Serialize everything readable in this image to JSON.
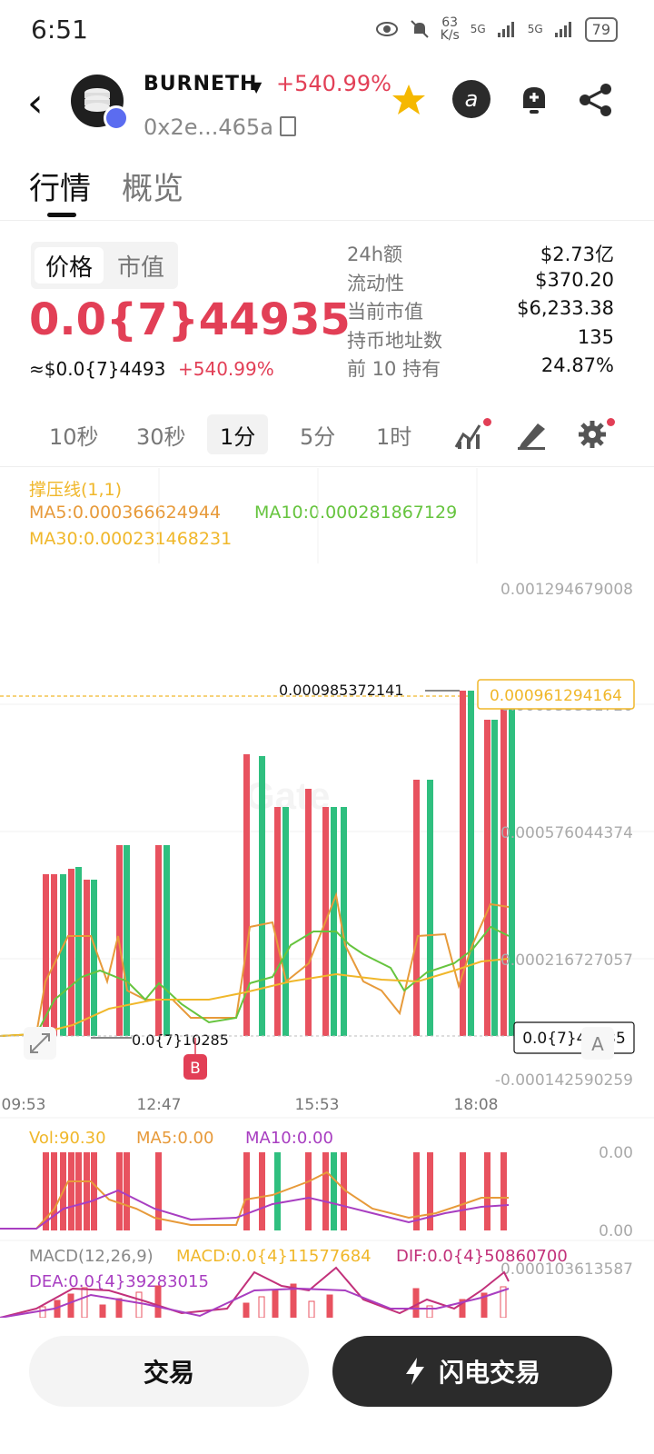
{
  "status_bar": {
    "time": "6:51",
    "net_speed_value": "63",
    "net_speed_unit": "K/s",
    "signal1": "5G",
    "signal2": "5G",
    "battery": "79"
  },
  "header": {
    "coin_name": "BURNETH",
    "change": "+540.99%",
    "address": "0x2e...465a"
  },
  "tabs": {
    "market": "行情",
    "overview": "概览"
  },
  "price_panel": {
    "toggle_price": "价格",
    "toggle_mcap": "市值",
    "price": "0.0{7}44935",
    "usd_price": "≈$0.0{7}4493",
    "usd_change": "+540.99%"
  },
  "stats": [
    {
      "label": "24h额",
      "value": "$2.73亿"
    },
    {
      "label": "流动性",
      "value": "$370.20"
    },
    {
      "label": "当前市值",
      "value": "$6,233.38"
    },
    {
      "label": "持币地址数",
      "value": "135"
    },
    {
      "label": "前 10 持有",
      "value": "24.87%"
    }
  ],
  "timeframes": {
    "items": [
      "10秒",
      "30秒",
      "1分",
      "5分",
      "1时"
    ],
    "selected": "1分"
  },
  "indicators": {
    "sr_line": "撑压线(1,1)",
    "ma5": "MA5:0.000366624944",
    "ma10": "MA10:0.000281867129",
    "ma30": "MA30:0.000231468231"
  },
  "colors": {
    "up": "#e8525f",
    "down": "#2fbf7f",
    "ma5": "#e79a3a",
    "ma10": "#66c43e",
    "ma30": "#f0b72a",
    "purple": "#a83ec1",
    "accent_red": "#e23f56"
  },
  "chart_data": {
    "type": "candlestick",
    "y_ticks": [
      "0.001294679008",
      "0.000576044374",
      "0.000216727057",
      "-0.000142590259"
    ],
    "y_tick_partial": "0.000935381720",
    "current_price_label": "0.000961294164",
    "high_label": "0.000985372141",
    "low_label": "0.0{7}10285",
    "last_price_label": "0.0{7}44935",
    "buy_marker": "B",
    "watermark": "Gate",
    "x_ticks": [
      "09:53",
      "12:47",
      "15:53",
      "18:08"
    ],
    "y_range": [
      -0.000142590259,
      0.001294679008
    ],
    "grid": true
  },
  "volume": {
    "vol": "Vol:90.30",
    "ma5": "MA5:0.00",
    "ma10": "MA10:0.00",
    "top_tick": "0.00",
    "bottom_tick": "0.00"
  },
  "macd": {
    "label": "MACD(12,26,9)",
    "macd": "MACD:0.0{4}11577684",
    "dif": "DIF:0.0{4}50860700",
    "dea": "DEA:0.0{4}39283015",
    "tick": "0.000103613587"
  },
  "bottom": {
    "trade": "交易",
    "flash_trade": "闪电交易"
  }
}
